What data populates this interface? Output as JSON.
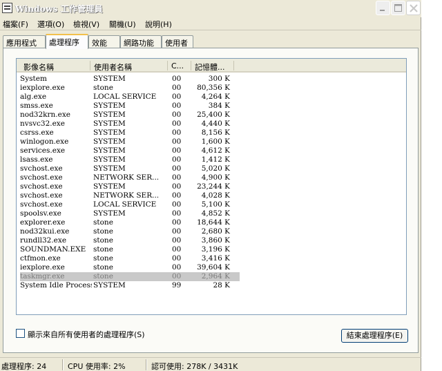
{
  "window": {
    "title": "Windows 工作管理員"
  },
  "menu": [
    {
      "label": "檔案(F)"
    },
    {
      "label": "選項(O)"
    },
    {
      "label": "檢視(V)"
    },
    {
      "label": "關機(U)"
    },
    {
      "label": "說明(H)"
    }
  ],
  "tabs": [
    {
      "label": "應用程式",
      "active": false
    },
    {
      "label": "處理程序",
      "active": true
    },
    {
      "label": "效能",
      "active": false
    },
    {
      "label": "網路功能",
      "active": false
    },
    {
      "label": "使用者",
      "active": false
    }
  ],
  "columns": {
    "name": "影像名稱",
    "user": "使用者名稱",
    "cpu": "C...",
    "mem": "記憶體..."
  },
  "processes": [
    {
      "name": "System",
      "user": "SYSTEM",
      "cpu": "00",
      "mem": "300 K"
    },
    {
      "name": "iexplore.exe",
      "user": "stone",
      "cpu": "00",
      "mem": "80,356 K"
    },
    {
      "name": "alg.exe",
      "user": "LOCAL SERVICE",
      "cpu": "00",
      "mem": "4,264 K"
    },
    {
      "name": "smss.exe",
      "user": "SYSTEM",
      "cpu": "00",
      "mem": "384 K"
    },
    {
      "name": "nod32krn.exe",
      "user": "SYSTEM",
      "cpu": "00",
      "mem": "25,400 K"
    },
    {
      "name": "nvsvc32.exe",
      "user": "SYSTEM",
      "cpu": "00",
      "mem": "4,440 K"
    },
    {
      "name": "csrss.exe",
      "user": "SYSTEM",
      "cpu": "00",
      "mem": "8,156 K"
    },
    {
      "name": "winlogon.exe",
      "user": "SYSTEM",
      "cpu": "00",
      "mem": "1,600 K"
    },
    {
      "name": "services.exe",
      "user": "SYSTEM",
      "cpu": "00",
      "mem": "4,612 K"
    },
    {
      "name": "lsass.exe",
      "user": "SYSTEM",
      "cpu": "00",
      "mem": "1,412 K"
    },
    {
      "name": "svchost.exe",
      "user": "SYSTEM",
      "cpu": "00",
      "mem": "5,020 K"
    },
    {
      "name": "svchost.exe",
      "user": "NETWORK SER...",
      "cpu": "00",
      "mem": "4,900 K"
    },
    {
      "name": "svchost.exe",
      "user": "SYSTEM",
      "cpu": "00",
      "mem": "23,244 K"
    },
    {
      "name": "svchost.exe",
      "user": "NETWORK SER...",
      "cpu": "00",
      "mem": "4,028 K"
    },
    {
      "name": "svchost.exe",
      "user": "LOCAL SERVICE",
      "cpu": "00",
      "mem": "5,100 K"
    },
    {
      "name": "spoolsv.exe",
      "user": "SYSTEM",
      "cpu": "00",
      "mem": "4,852 K"
    },
    {
      "name": "explorer.exe",
      "user": "stone",
      "cpu": "00",
      "mem": "18,644 K"
    },
    {
      "name": "nod32kui.exe",
      "user": "stone",
      "cpu": "00",
      "mem": "2,680 K"
    },
    {
      "name": "rundll32.exe",
      "user": "stone",
      "cpu": "00",
      "mem": "3,860 K"
    },
    {
      "name": "SOUNDMAN.EXE",
      "user": "stone",
      "cpu": "00",
      "mem": "3,196 K"
    },
    {
      "name": "ctfmon.exe",
      "user": "stone",
      "cpu": "00",
      "mem": "3,416 K"
    },
    {
      "name": "iexplore.exe",
      "user": "stone",
      "cpu": "00",
      "mem": "39,604 K"
    },
    {
      "name": "taskmgr.exe",
      "user": "stone",
      "cpu": "00",
      "mem": "2,964 K",
      "selected": true
    },
    {
      "name": "System Idle Process",
      "user": "SYSTEM",
      "cpu": "99",
      "mem": "28 K"
    }
  ],
  "show_all_label": "顯示來自所有使用者的處理程序(S)",
  "end_process_label": "結束處理程序(E)",
  "status": {
    "processes": "處理程序: 24",
    "cpu": "CPU 使用率: 2%",
    "commit": "認可使用: 278K / 3431K"
  }
}
